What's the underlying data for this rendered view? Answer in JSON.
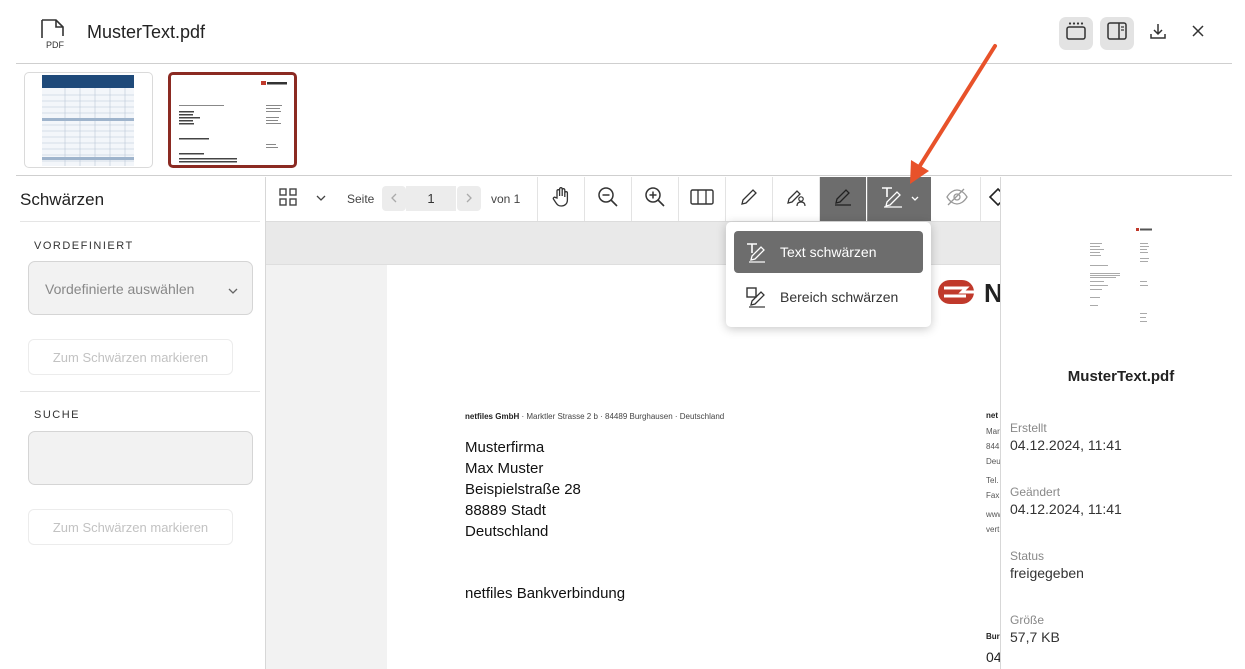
{
  "header": {
    "file_icon_label": "PDF",
    "title": "MusterText.pdf"
  },
  "left_panel": {
    "title": "Schwärzen",
    "predefined_label": "VORDEFINIERT",
    "predefined_placeholder": "Vordefinierte auswählen",
    "mark_button_1": "Zum Schwärzen markieren",
    "search_label": "SUCHE",
    "mark_button_2": "Zum Schwärzen markieren"
  },
  "toolbar": {
    "page_label": "Seite",
    "page_value": "1",
    "of_label": "von 1"
  },
  "dropdown": {
    "items": [
      {
        "label": "Text schwärzen"
      },
      {
        "label": "Bereich schwärzen"
      }
    ]
  },
  "document": {
    "sender_company": "netfiles GmbH",
    "sender_rest": " · Marktler Strasse 2 b · 84489 Burghausen · Deutschland",
    "address": [
      "Musterfirma",
      "Max Muster",
      "Beispielstraße 28",
      "88889 Stadt",
      "Deutschland"
    ],
    "bank_heading": "netfiles Bankverbindung",
    "logo_letter": "N",
    "side_col": [
      "net",
      "Mar",
      "844",
      "Deu",
      "Tel.",
      "Fax",
      "www",
      "vert",
      "Bur",
      "04"
    ]
  },
  "right_panel": {
    "file_name": "MusterText.pdf",
    "created_label": "Erstellt",
    "created_value": "04.12.2024, 11:41",
    "modified_label": "Geändert",
    "modified_value": "04.12.2024, 11:41",
    "status_label": "Status",
    "status_value": "freigegeben",
    "size_label": "Größe",
    "size_value": "57,7 KB"
  },
  "colors": {
    "accent": "#8b2a22",
    "toolbar_active": "#6d6d6d",
    "annotation_arrow": "#e8522a",
    "logo_red": "#c0392b"
  }
}
